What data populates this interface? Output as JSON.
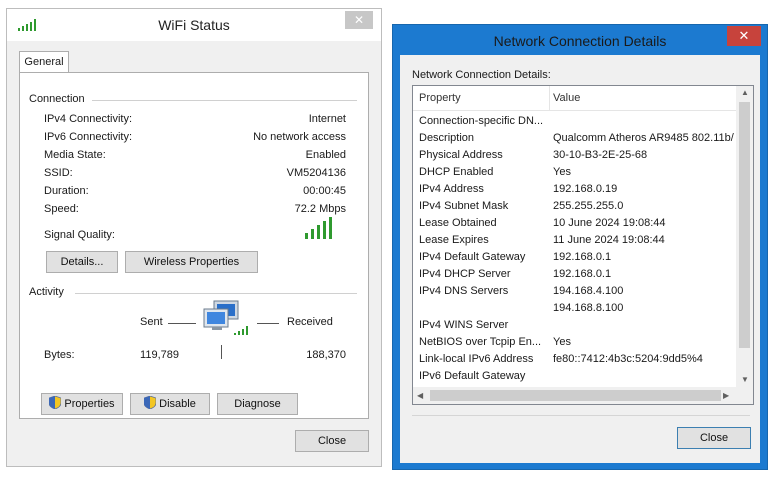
{
  "wifi": {
    "title": "WiFi Status",
    "close_symbol": "✕",
    "tab": "General",
    "connection": {
      "heading": "Connection",
      "rows": [
        {
          "label": "IPv4 Connectivity:",
          "value": "Internet"
        },
        {
          "label": "IPv6 Connectivity:",
          "value": "No network access"
        },
        {
          "label": "Media State:",
          "value": "Enabled"
        },
        {
          "label": "SSID:",
          "value": "VM5204136"
        },
        {
          "label": "Duration:",
          "value": "00:00:45"
        },
        {
          "label": "Speed:",
          "value": "72.2 Mbps"
        }
      ],
      "signal_label": "Signal Quality:",
      "signal_level": 5,
      "signal_max": 5,
      "details_button": "Details...",
      "wireless_button": "Wireless Properties"
    },
    "activity": {
      "heading": "Activity",
      "sent_label": "Sent",
      "received_label": "Received",
      "bytes_label": "Bytes:",
      "bytes_sent": "119,789",
      "bytes_received": "188,370"
    },
    "properties_button": "Properties",
    "disable_button": "Disable",
    "diagnose_button": "Diagnose",
    "close_button": "Close",
    "signal_color": "#2f9a2f"
  },
  "details": {
    "title": "Network Connection Details",
    "close_symbol": "✕",
    "group_label": "Network Connection Details:",
    "col_property": "Property",
    "col_value": "Value",
    "rows": [
      {
        "property": "Connection-specific DN...",
        "value": ""
      },
      {
        "property": "Description",
        "value": "Qualcomm Atheros AR9485 802.11b/"
      },
      {
        "property": "Physical Address",
        "value": "30-10-B3-2E-25-68"
      },
      {
        "property": "DHCP Enabled",
        "value": "Yes"
      },
      {
        "property": "IPv4 Address",
        "value": "192.168.0.19"
      },
      {
        "property": "IPv4 Subnet Mask",
        "value": "255.255.255.0"
      },
      {
        "property": "Lease Obtained",
        "value": "10 June 2024 19:08:44"
      },
      {
        "property": "Lease Expires",
        "value": "11 June 2024 19:08:44"
      },
      {
        "property": "IPv4 Default Gateway",
        "value": "192.168.0.1"
      },
      {
        "property": "IPv4 DHCP Server",
        "value": "192.168.0.1"
      },
      {
        "property": "IPv4 DNS Servers",
        "value": "194.168.4.100"
      },
      {
        "property": "",
        "value": "194.168.8.100"
      },
      {
        "property": "IPv4 WINS Server",
        "value": ""
      },
      {
        "property": "NetBIOS over Tcpip En...",
        "value": "Yes"
      },
      {
        "property": "Link-local IPv6 Address",
        "value": "fe80::7412:4b3c:5204:9dd5%4"
      },
      {
        "property": "IPv6 Default Gateway",
        "value": ""
      }
    ],
    "close_button": "Close",
    "titlebar_color": "#1c7ad0",
    "close_color": "#c7433c"
  }
}
